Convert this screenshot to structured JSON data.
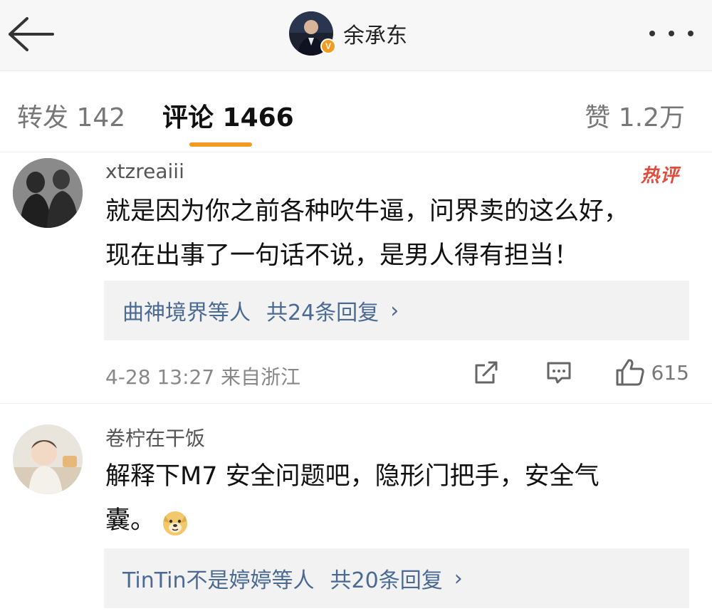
{
  "header": {
    "title": "余承东",
    "badge": "V"
  },
  "tabs": {
    "repost": "转发 142",
    "comment": "评论 1466",
    "like": "赞 1.2万"
  },
  "comments": [
    {
      "username": "xtzreaiii",
      "tag": "热评",
      "text_line1": "就是因为你之前各种吹牛逼，问界卖的这么好，",
      "text_line2": "现在出事了一句话不说，是男人得有担当！",
      "reply_who": "曲神境界等人",
      "reply_count": "共24条回复",
      "reply_chevron": "›",
      "meta": "4-28 13:27 来自浙江",
      "likes": "615"
    },
    {
      "username": "卷柠在干饭",
      "text_line1": "解释下M7 安全问题吧，隐形门把手，安全气",
      "text_line2": "囊。",
      "reply_who": "TinTin不是婷婷等人",
      "reply_count": "共20条回复",
      "reply_chevron": "›"
    }
  ],
  "colors": {
    "accent": "#f39a23",
    "link": "#4a6a93",
    "hot": "#e24b3b"
  },
  "icons": [
    "back-arrow-icon",
    "more-dots-icon",
    "repost-icon",
    "comment-icon",
    "like-icon",
    "doge-emoji-icon"
  ]
}
